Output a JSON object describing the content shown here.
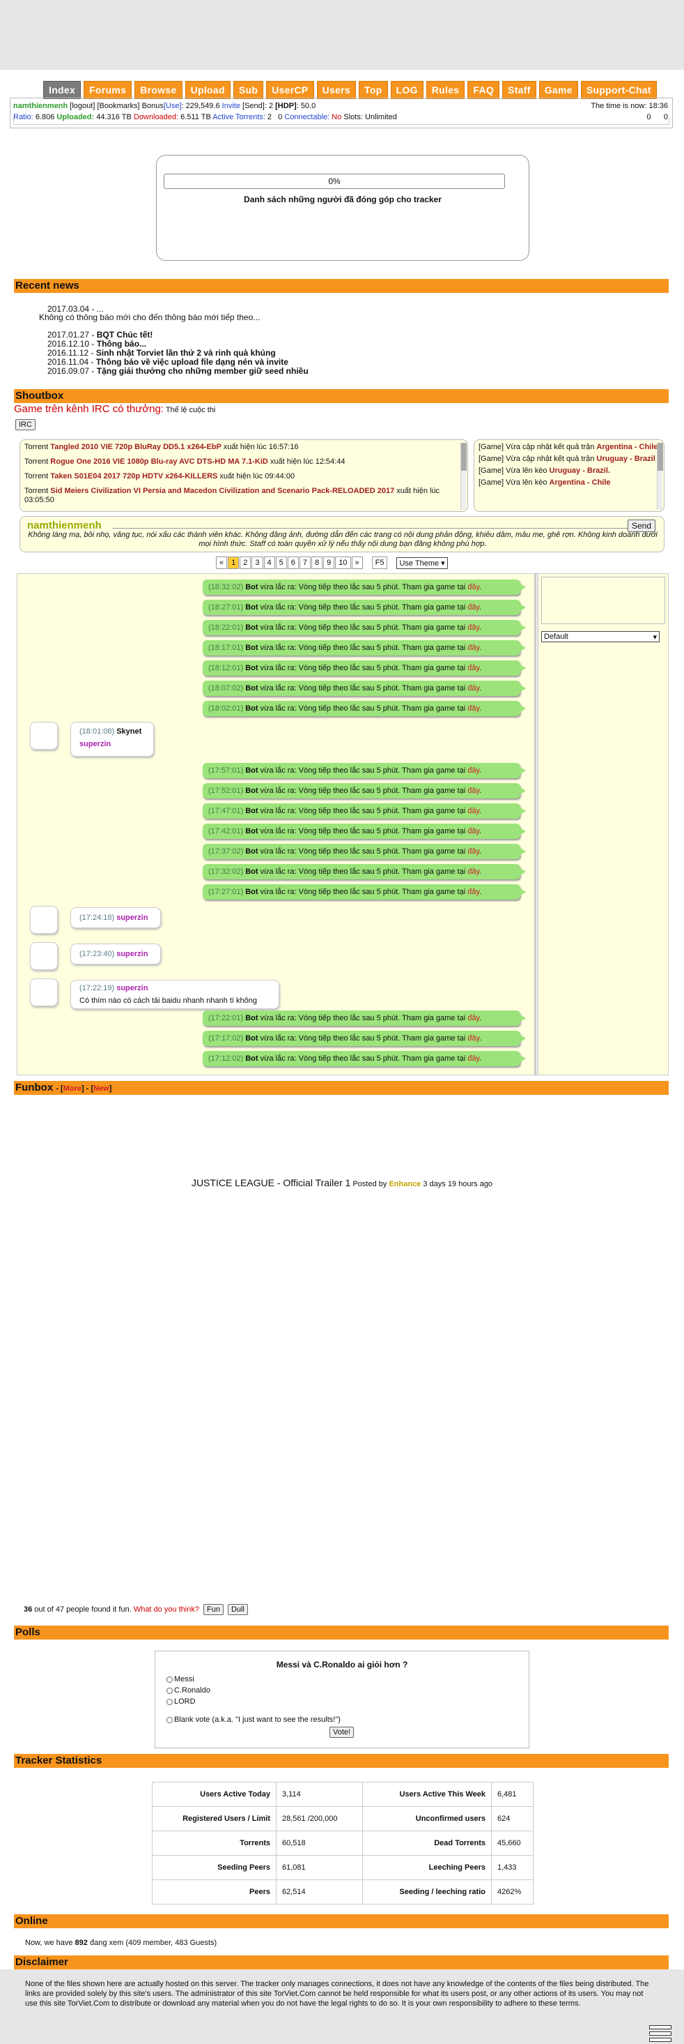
{
  "nav": [
    "Index",
    "Forums",
    "Browse",
    "Upload",
    "Sub",
    "UserCP",
    "Users",
    "Top",
    "LOG",
    "Rules",
    "FAQ",
    "Staff",
    "Game",
    "Support-Chat"
  ],
  "userbar": {
    "username": "namthienmenh",
    "links": "[logout] [Bookmarks]",
    "bonus_label": "Bonus",
    "bonus_use": "[Use]",
    "bonus_value": ": 229,549.6",
    "invite": "Invite",
    "send": "[Send]: 2",
    "hdp_label": "[HDP]",
    "hdp_value": ": 50.0",
    "ratio_label": "Ratio:",
    "ratio_value": "6.806",
    "uploaded_label": "Uploaded:",
    "uploaded_value": "44.316 TB",
    "downloaded_label": "Downloaded:",
    "downloaded_value": "6.511 TB",
    "active_label": "Active Torrents:",
    "active_value": "2   0",
    "connectable_label": "Connectable:",
    "connectable_value": "No",
    "slots": "Slots: Unlimited",
    "time": "The time is now: 18:36",
    "counts": "0      0"
  },
  "progress": {
    "percent_text": "0%",
    "fraction": 0,
    "caption": "Danh sách những người đã đóng góp cho tracker"
  },
  "sections": {
    "news": "Recent news",
    "shoutbox": "Shoutbox",
    "funbox": "Funbox",
    "funbox_more": "More",
    "funbox_new": "New",
    "polls": "Polls",
    "stats": "Tracker Statistics",
    "online": "Online",
    "disclaimer": "Disclaimer"
  },
  "news": {
    "top_date": "2017.03.04 - ...",
    "top_text": "Không có thông báo mới cho đến thông báo mới tiếp theo...",
    "items": [
      {
        "date": "2017.01.27 - ",
        "title": "BQT Chúc tết!"
      },
      {
        "date": "2016.12.10 - ",
        "title": "Thông báo..."
      },
      {
        "date": "2016.11.12 - ",
        "title": "Sinh nhật Torviet lần thứ 2 và rinh quà khủng"
      },
      {
        "date": "2016.11.04 - ",
        "title": "Thông báo về việc upload file dạng nén và invite"
      },
      {
        "date": "2016.09.07 - ",
        "title": "Tặng giải thưởng cho những member giữ seed nhiều"
      }
    ]
  },
  "irc": {
    "headline": "Game trên kênh IRC có thưởng:",
    "tail": " Thể lệ cuộc thi",
    "button": "IRC"
  },
  "torrents": [
    {
      "prefix": "Torrent ",
      "name": "Tangled 2010 VIE 720p BluRay DD5.1 x264-EbP",
      "suffix": " xuất hiện lúc 16:57:16"
    },
    {
      "prefix": "Torrent ",
      "name": "Rogue One 2016 VIE 1080p Blu-ray AVC DTS-HD MA 7.1-KiD",
      "suffix": " xuất hiện lúc 12:54:44"
    },
    {
      "prefix": "Torrent ",
      "name": "Taken S01E04 2017 720p HDTV x264-KILLERS",
      "suffix": " xuất hiện lúc 09:44:00"
    },
    {
      "prefix": "Torrent ",
      "name": "Sid Meiers Civilization VI Persia and Macedon Civilization and Scenario Pack-RELOADED 2017",
      "suffix": " xuất hiện lúc 03:05:50"
    }
  ],
  "games": [
    {
      "text": "[Game] Vừa cập nhật kết quả trận ",
      "team": "Argentina - Chile"
    },
    {
      "text": "[Game] Vừa cập nhật kết quả trận ",
      "team": "Uruguay - Brazil"
    },
    {
      "text": "[Game] Vừa lên kèo ",
      "team": "Uruguay - Brazil."
    },
    {
      "text": "[Game] Vừa lên kèo ",
      "team": "Argentina - Chile"
    }
  ],
  "shout_form": {
    "name": "namthienmenh",
    "send": "Send",
    "rules": "Không láng mạ, bôi nhọ, văng tục, nói xấu các thành viên khác. Không đăng ảnh, đường dẫn đến các trang có nội dung phản động, khiêu dâm, mâu me, ghê rợn. Không kinh doanh dưới mọi hình thức. Staff có toàn quyền xử lý nếu thấy nội dung bạn đăng không phù hợp."
  },
  "pager": {
    "prev": "«",
    "pages": [
      "1",
      "2",
      "3",
      "4",
      "5",
      "6",
      "7",
      "8",
      "9",
      "10"
    ],
    "next": "»",
    "refresh": "F5",
    "theme": "Use Theme ▾"
  },
  "side_select": "Default",
  "bot": {
    "name": "Bot",
    "text": " vừa lắc ra:  Vòng tiếp theo lắc sau 5 phút. Tham gia game tại ",
    "link": "đây",
    "end": "."
  },
  "bot_times_a": [
    "(18:32:02)",
    "(18:27:01)",
    "(18:22:01)",
    "(18:17:01)",
    "(18:12:01)",
    "(18:07:02)",
    "(18:02:01)"
  ],
  "user_msg1": {
    "time": "(18:01:08)",
    "name": "Skynet",
    "sub": "superzin"
  },
  "bot_times_b": [
    "(17:57:01)",
    "(17:52:01)",
    "(17:47:01)",
    "(17:42:01)",
    "(17:37:02)",
    "(17:32:02)",
    "(17:27:01)"
  ],
  "user_msg2": {
    "time": "(17:24:18)",
    "name": "superzin"
  },
  "user_msg3": {
    "time": "(17:23:40)",
    "name": "superzin"
  },
  "user_msg4": {
    "time": "(17:22:19)",
    "name": "superzin",
    "text": "Có thím nào có cách tải baidu nhanh nhanh tí không"
  },
  "bot_times_c": [
    "(17:22:01)",
    "(17:17:02)",
    "(17:12:02)"
  ],
  "funbox": {
    "title": "JUSTICE LEAGUE - Official Trailer 1",
    "posted": " Posted by ",
    "by": "Enhance",
    "ago": " 3 days 19 hours ago",
    "count": "36",
    "count_text": " out of 47 people found it fun. ",
    "think": "What do you think?",
    "fun_btn": "Fun",
    "dull_btn": "Dull"
  },
  "poll": {
    "question": "Messi và C.Ronaldo ai giỏi hơn ?",
    "options": [
      "Messi",
      "C.Ronaldo",
      "LORD"
    ],
    "blank": "Blank vote (a.k.a. \"I just want to see the results!\")",
    "vote": "Vote!"
  },
  "stats": [
    [
      "Users Active Today",
      "3,114",
      "Users Active This Week",
      "6,481"
    ],
    [
      "Registered Users / Limit",
      "28,561 /200,000",
      "Unconfirmed users",
      "624"
    ],
    [
      "Torrents",
      "60,518",
      "Dead Torrents",
      "45,660"
    ],
    [
      "Seeding Peers",
      "61,081",
      "Leeching Peers",
      "1,433"
    ],
    [
      "Peers",
      "62,514",
      "Seeding / leeching ratio",
      "4262%"
    ]
  ],
  "online": {
    "pre": "Now, we have ",
    "count": "892",
    "post": " đang xem (409 member, 483 Guests)"
  },
  "disclaimer": "None of the files shown here are actually hosted on this server. The tracker only manages connections, it does not have any knowledge of the contents of the files being distributed. The links are provided solely by this site's users. The administrator of this site TorViet.Com cannot be held responsible for what its users post, or any other actions of its users. You may not use this site TorViet.Com to distribute or download any material when you do not have the legal rights to do so. It is your own responsibility to adhere to these terms.",
  "colors": {
    "accent": "#f7941d",
    "bot_bubble": "#9be37a",
    "shout_bg": "#ffffe0"
  }
}
